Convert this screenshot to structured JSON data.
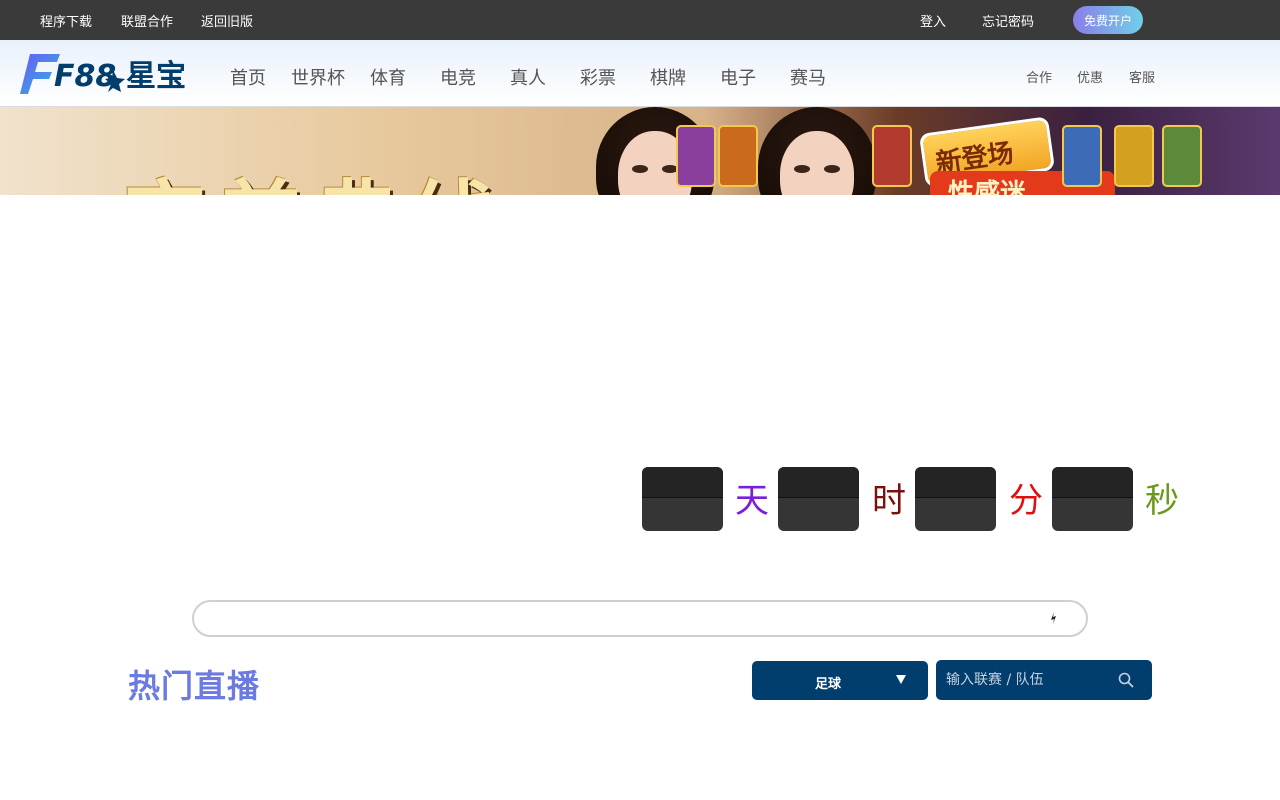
{
  "topbar": {
    "download": "程序下载",
    "alliance": "联盟合作",
    "old_version": "返回旧版",
    "login": "登入",
    "forgot_password": "忘记密码",
    "signup": "免费开户"
  },
  "brand": {
    "logo_text": "F88",
    "logo_cn": "星宝"
  },
  "nav": {
    "items": [
      "首页",
      "世界杯",
      "体育",
      "电竞",
      "真人",
      "彩票",
      "棋牌",
      "电子",
      "赛马"
    ],
    "right": [
      "合作",
      "优惠",
      "客服"
    ]
  },
  "banner": {
    "headline": "完美典线",
    "tag_top": "新登场",
    "tag_bottom": "性感迷"
  },
  "countdown": {
    "days_value": "",
    "hours_value": "",
    "minutes_value": "",
    "seconds_value": "",
    "units": {
      "days": "天",
      "hours": "时",
      "minutes": "分",
      "seconds": "秒"
    },
    "unit_colors": {
      "days": "#7a1fd8",
      "hours": "#7a1111",
      "minutes": "#e01010",
      "seconds": "#6a9a1a"
    }
  },
  "search": {
    "placeholder": ""
  },
  "live": {
    "title": "热门直播",
    "sport_selected": "足球",
    "team_placeholder": "输入联赛 / 队伍"
  },
  "colors": {
    "topbar_bg": "#3a3a3a",
    "accent_blue": "#013e6e",
    "title_purple": "#6b7be2"
  }
}
